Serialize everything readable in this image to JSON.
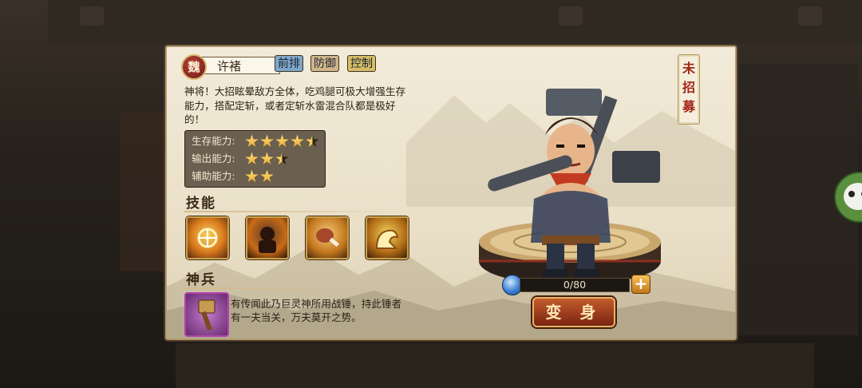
{
  "hero": {
    "faction": "魏",
    "name": "许褚",
    "tags": [
      "前排",
      "防御",
      "控制"
    ],
    "description": "神将！大招眩晕敌方全体，吃鸡腿可极大增强生存能力，搭配定斩，或者定斩水雷混合队都是极好的！",
    "status": "未招募"
  },
  "stats": [
    {
      "label": "生存能力:",
      "stars": 4.5
    },
    {
      "label": "输出能力:",
      "stars": 2.5
    },
    {
      "label": "辅助能力:",
      "stars": 2
    }
  ],
  "sections": {
    "skills_title": "技能",
    "weapon_title": "神兵"
  },
  "skills": [
    {
      "icon": "stun-aoe-skill-icon"
    },
    {
      "icon": "rage-warrior-skill-icon"
    },
    {
      "icon": "drumstick-skill-icon"
    },
    {
      "icon": "strength-arm-skill-icon"
    }
  ],
  "weapon": {
    "icon": "war-hammer-icon",
    "description": "有传闻此乃巨灵神所用战锤，持此锤者有一夫当关，万夫莫开之势。"
  },
  "fragments": {
    "label": "0/80",
    "current": 0,
    "total": 80
  },
  "actions": {
    "transform_label": "变 身",
    "add_label": "+"
  },
  "colors": {
    "accent_red": "#a22619",
    "gold": "#e7a22a",
    "tag_blue": "#7fa7c9"
  }
}
